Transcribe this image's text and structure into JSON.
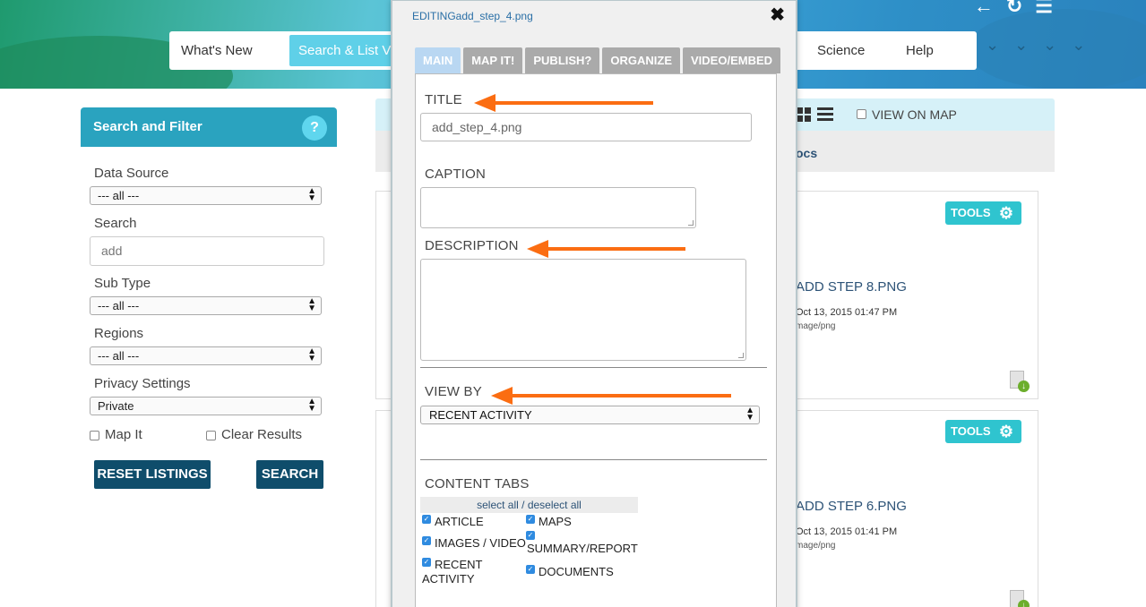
{
  "header": {
    "nav_items": [
      "What's New",
      "Search & List V",
      "Science",
      "Help"
    ],
    "top_icons": [
      "back-arrow-icon",
      "refresh-icon",
      "list-menu-icon"
    ]
  },
  "sidebar": {
    "title": "Search and Filter",
    "help_label": "?",
    "data_source": {
      "label": "Data Source",
      "value": "--- all ---"
    },
    "search": {
      "label": "Search",
      "value": "add"
    },
    "sub_type": {
      "label": "Sub Type",
      "value": "--- all ---"
    },
    "regions": {
      "label": "Regions",
      "value": "--- all ---"
    },
    "privacy": {
      "label": "Privacy Settings",
      "value": "Private"
    },
    "map_it_label": "Map It",
    "clear_results_label": "Clear Results",
    "reset_button": "RESET LISTINGS",
    "search_button": "SEARCH"
  },
  "content": {
    "view_on_map_label": "VIEW ON MAP",
    "docs_label": "ocs",
    "cards": [
      {
        "tools_label": "TOOLS",
        "title": "ADD STEP 8.PNG",
        "date": "Oct 13, 2015 01:47 PM",
        "type": "mage/png"
      },
      {
        "tools_label": "TOOLS",
        "title": "ADD STEP 6.PNG",
        "date": "Oct 13, 2015 01:41 PM",
        "type": "mage/png"
      }
    ]
  },
  "modal": {
    "title_prefix": "EDITING",
    "title_file": "add_step_4.png",
    "close_symbol": "✖",
    "tabs": [
      "MAIN",
      "MAP IT!",
      "PUBLISH?",
      "ORGANIZE",
      "VIDEO/EMBED"
    ],
    "active_tab": "MAIN",
    "title_label": "TITLE",
    "title_value": "add_step_4.png",
    "caption_label": "CAPTION",
    "description_label": "DESCRIPTION",
    "view_by_label": "VIEW BY",
    "view_by_value": "RECENT ACTIVITY",
    "content_tabs_label": "CONTENT TABS",
    "select_all_text": "select all / deselect all",
    "content_tabs": {
      "article": "ARTICLE",
      "maps": "MAPS",
      "images_video": "IMAGES / VIDEO",
      "summary_report": "SUMMARY/REPORT",
      "recent_activity": "RECENT ACTIVITY",
      "documents": "DOCUMENTS"
    },
    "arrow_color": "#fb6d12"
  }
}
